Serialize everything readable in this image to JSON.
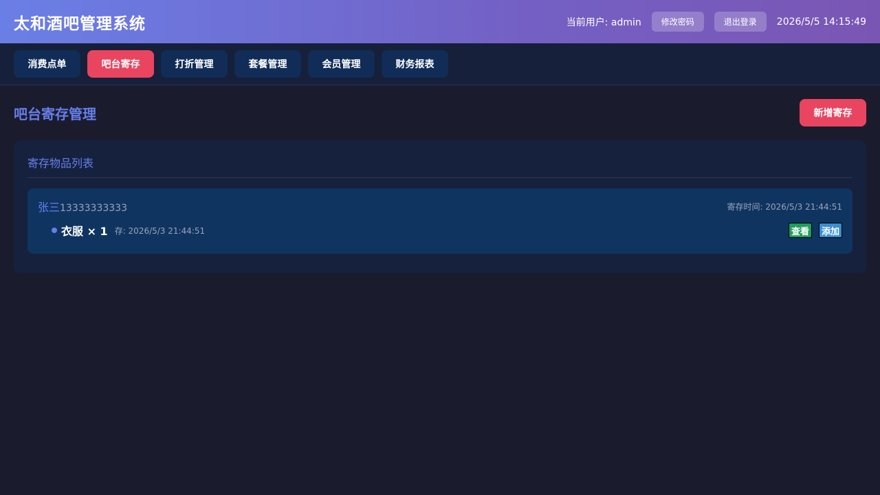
{
  "header": {
    "title": "太和酒吧管理系统",
    "current_user": "当前用户: admin",
    "change_password": "修改密码",
    "logout": "退出登录",
    "datetime": "2026/5/5 14:15:49"
  },
  "nav": {
    "tabs": [
      {
        "label": "消费点单",
        "active": false
      },
      {
        "label": "吧台寄存",
        "active": true
      },
      {
        "label": "打折管理",
        "active": false
      },
      {
        "label": "套餐管理",
        "active": false
      },
      {
        "label": "会员管理",
        "active": false
      },
      {
        "label": "财务报表",
        "active": false
      }
    ]
  },
  "main": {
    "page_title": "吧台寄存管理",
    "add_button": "新增寄存",
    "panel_title": "寄存物品列表",
    "records": [
      {
        "customer_name": "张三",
        "phone": "13333333333",
        "time": "寄存时间: 2026/5/3 21:44:51",
        "items": [
          {
            "name": "衣服 × 1",
            "time": "存: 2026/5/3 21:44:51",
            "view_label": "查看",
            "add_label": "添加"
          }
        ]
      }
    ]
  },
  "colors": {
    "accent": "#667eea",
    "primary_red": "#e94560",
    "background": "#1b1b2e",
    "panel": "#16213e",
    "card": "#0f3460"
  }
}
